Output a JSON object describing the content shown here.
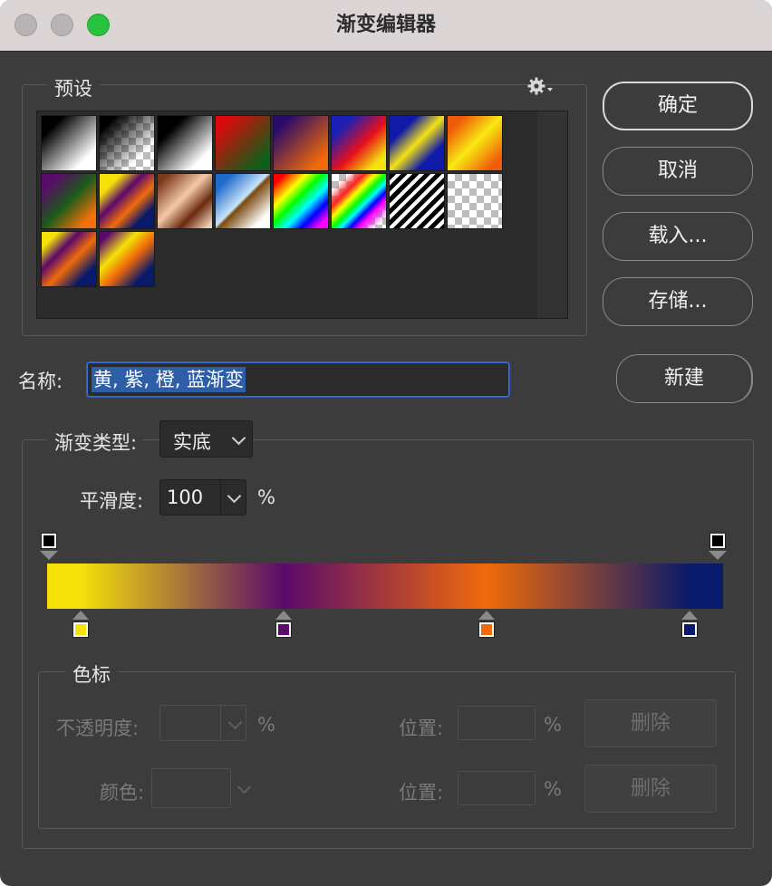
{
  "window": {
    "title": "渐变编辑器"
  },
  "presets": {
    "legend": "预设",
    "settings_icon": "gear-icon",
    "swatches": [
      {
        "name": "foreground-to-background",
        "css": "linear-gradient(135deg,#000 20%,#fff 80%)"
      },
      {
        "name": "foreground-to-transparent",
        "css": "linear-gradient(135deg,#000 15%,rgba(0,0,0,0) 75%)"
      },
      {
        "name": "black-white",
        "css": "linear-gradient(135deg,#000 25%,#fff 80%)"
      },
      {
        "name": "red-green",
        "css": "linear-gradient(135deg,#d80a0a 15%,#0f5f1a 85%)"
      },
      {
        "name": "violet-orange",
        "css": "linear-gradient(135deg,#2a0a6a 15%,#f16a08 85%)"
      },
      {
        "name": "blue-red-yellow",
        "css": "linear-gradient(135deg,#1b1fb3 20%,#e8101a 55%,#f3e50c 85%)"
      },
      {
        "name": "blue-yellow-blue",
        "css": "linear-gradient(135deg,#101aa8 25%,#f2e213 50%,#101aa8 75%)"
      },
      {
        "name": "orange-yellow-orange",
        "css": "linear-gradient(135deg,#f05a08 15%,#f8e812 50%,#f05a08 88%)"
      },
      {
        "name": "violet-green-orange",
        "css": "linear-gradient(135deg,#5a0a6a 15%,#1a5a1a 50%,#f5700a 85%)"
      },
      {
        "name": "yellow-violet-orange-blue",
        "css": "linear-gradient(135deg,#f5e00a 20%,#5a0a6a 40%,#f06a0a 60%,#0a1a6a 80%)"
      },
      {
        "name": "copper",
        "css": "linear-gradient(135deg,#7a3a1a 10%,#f2c8a8 45%,#6a2a10 70%,#f0d0b8 95%)"
      },
      {
        "name": "chrome",
        "css": "linear-gradient(135deg,#1f6acb 15%,#c8e4f8 48%,#7a4a10 52%,#ffffff 85%)"
      },
      {
        "name": "spectrum",
        "css": "linear-gradient(135deg,#ff0000 10%,#ffff00 30%,#00ff00 45%,#00ffff 60%,#0000ff 75%,#ff00ff 90%)"
      },
      {
        "name": "transparent-rainbow",
        "css": "linear-gradient(135deg,rgba(255,0,0,0) 15%,#ff2020 30%,#ffff00 40%,#00ff00 50%,#00ffff 58%,#0000ff 66%,#ff00ff 74%,rgba(255,0,255,0) 90%)"
      },
      {
        "name": "transparent-stripes",
        "css": "repeating-linear-gradient(135deg,#000 0 5px,#ffffff 5px 9px)"
      },
      {
        "name": "transparent-grid",
        "css": "none"
      },
      {
        "name": "yellow-violet-orange-blue-2",
        "css": "linear-gradient(135deg,#f5e00a 15%,#5a0a6a 35%,#f06a0a 55%,#0a1a6a 80%)"
      },
      {
        "name": "yellow-violet-orange-blue-3",
        "css": "linear-gradient(135deg,#5a0a6a 10%,#f5e00a 35%,#f06a0a 55%,#0a1a6a 80%)"
      }
    ]
  },
  "buttons": {
    "ok": "确定",
    "cancel": "取消",
    "load": "载入...",
    "save": "存储...",
    "new": "新建"
  },
  "name_field": {
    "label": "名称:",
    "value": "黄, 紫, 橙, 蓝渐变"
  },
  "gradient": {
    "type_label": "渐变类型:",
    "type_value": "实底",
    "smooth_label": "平滑度:",
    "smooth_value": "100",
    "smooth_unit": "%",
    "opacity_stops": [
      {
        "location_pct": 0,
        "color": "#000000"
      },
      {
        "location_pct": 100,
        "color": "#000000"
      }
    ],
    "color_stops": [
      {
        "location_pct": 5,
        "color": "#f5e00a"
      },
      {
        "location_pct": 35,
        "color": "#5a0a6a"
      },
      {
        "location_pct": 65,
        "color": "#f06a0a"
      },
      {
        "location_pct": 95,
        "color": "#0a1a6a"
      }
    ]
  },
  "stops_panel": {
    "legend": "色标",
    "opacity_label": "不透明度:",
    "opacity_unit": "%",
    "location_label_1": "位置:",
    "location_unit_1": "%",
    "delete_1": "删除",
    "color_label": "颜色:",
    "location_label_2": "位置:",
    "location_unit_2": "%",
    "delete_2": "删除"
  }
}
